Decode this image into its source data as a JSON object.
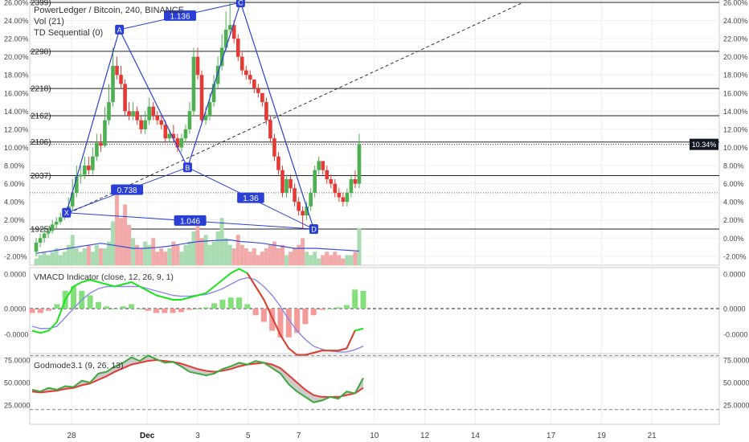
{
  "header": {
    "symbol_line": "PowerLedger / Bitcoin, 240, BINANCE",
    "vol_line": "Vol (21)",
    "td_line": "TD Sequential (0)"
  },
  "macd_panel": {
    "label": "VMACD Indicator (close, 12, 26, 9, 1)"
  },
  "godmode_panel": {
    "label": "Godmode3.1 (9, 26, 13)"
  },
  "colors": {
    "up": "#4caf50",
    "down": "#e53935",
    "pattern": "#2a3fd6",
    "macd_line": "#19e619",
    "signal_line": "#8888ee",
    "godmode_green": "#3ea83e",
    "godmode_red": "#e53935",
    "shade": "#bfbfbf"
  },
  "chart_data": [
    {
      "type": "line",
      "title": "PowerLedger / Bitcoin, 240, BINANCE",
      "ylim": [
        -2.0,
        26.0
      ],
      "y_ticks": [
        "26.00%",
        "24.00%",
        "22.00%",
        "20.00%",
        "18.00%",
        "16.00%",
        "14.00%",
        "12.00%",
        "10.00%",
        "8.00%",
        "6.00%",
        "4.00%",
        "2.00%",
        "0.00%",
        "-2.00%"
      ],
      "x_ticks": [
        "28",
        "Dec",
        "3",
        "5",
        "7",
        "10",
        "12",
        "14",
        "17",
        "19",
        "21"
      ],
      "x_tick_days": [
        28,
        31,
        33,
        35,
        37,
        40,
        42,
        44,
        47,
        49,
        51
      ],
      "price_levels": [
        {
          "label": "2399",
          "value": 26.0
        },
        {
          "label": "2298",
          "value": 20.6
        },
        {
          "label": "2218",
          "value": 16.5
        },
        {
          "label": "2162",
          "value": 13.5
        },
        {
          "label": "2106",
          "value": 10.6
        },
        {
          "label": "2037",
          "value": 6.9
        },
        {
          "label": "1925",
          "value": 1.0
        }
      ],
      "current_value_label": "10.34%",
      "current_value": 10.34,
      "harmonic_pattern": {
        "points": [
          {
            "label": "X",
            "day": 27.8,
            "value": 2.8
          },
          {
            "label": "A",
            "day": 29.9,
            "value": 23.0
          },
          {
            "label": "B",
            "day": 32.6,
            "value": 7.8
          },
          {
            "label": "C",
            "day": 34.7,
            "value": 26.0
          },
          {
            "label": "D",
            "day": 37.6,
            "value": 1.0
          }
        ],
        "ratios": [
          {
            "label": "1.136",
            "between": "A-C"
          },
          {
            "label": "0.738",
            "between": "X-B"
          },
          {
            "label": "1.36",
            "between": "B-D"
          },
          {
            "label": "1.046",
            "between": "X-D"
          }
        ]
      },
      "series": [
        {
          "kind": "candlestick",
          "days": [
            26.6,
            26.76,
            26.92,
            27.08,
            27.24,
            27.4,
            27.56,
            27.72,
            27.88,
            28.04,
            28.2,
            28.36,
            28.52,
            28.68,
            28.84,
            29.0,
            29.16,
            29.32,
            29.48,
            29.64,
            29.8,
            29.96,
            30.12,
            30.28,
            30.44,
            30.6,
            30.76,
            30.92,
            31.08,
            31.24,
            31.4,
            31.56,
            31.72,
            31.88,
            32.04,
            32.2,
            32.36,
            32.52,
            32.68,
            32.84,
            33.0,
            33.16,
            33.32,
            33.48,
            33.64,
            33.8,
            33.96,
            34.12,
            34.28,
            34.44,
            34.6,
            34.76,
            34.92,
            35.08,
            35.24,
            35.4,
            35.56,
            35.72,
            35.88,
            36.04,
            36.2,
            36.36,
            36.52,
            36.68,
            36.84,
            37.0,
            37.16,
            37.32,
            37.48,
            37.64,
            37.8,
            37.96,
            38.12,
            38.28,
            38.44,
            38.6,
            38.76,
            38.92,
            39.08,
            39.24,
            39.4
          ],
          "open": [
            -1.5,
            -0.5,
            0.0,
            0.5,
            0.8,
            1.5,
            1.8,
            2.3,
            2.8,
            3.5,
            5.0,
            6.8,
            7.0,
            8.0,
            7.5,
            9.0,
            10.5,
            10.2,
            13.0,
            15.0,
            19.0,
            18.0,
            17.0,
            14.0,
            13.5,
            14.0,
            13.0,
            12.0,
            13.0,
            14.5,
            13.5,
            13.0,
            12.5,
            11.0,
            11.5,
            11.0,
            10.0,
            11.0,
            12.0,
            14.0,
            20.0,
            18.0,
            13.0,
            13.5,
            15.0,
            17.0,
            19.0,
            21.0,
            23.0,
            23.5,
            22.0,
            20.0,
            18.5,
            18.0,
            17.5,
            16.5,
            16.0,
            15.0,
            13.0,
            11.0,
            9.0,
            7.5,
            5.0,
            6.5,
            5.5,
            4.0,
            3.0,
            2.5,
            3.5,
            5.0,
            7.5,
            8.5,
            7.5,
            6.5,
            6.0,
            5.0,
            4.5,
            4.0,
            5.0,
            6.5,
            6.0
          ],
          "close": [
            -0.5,
            0.0,
            0.5,
            0.8,
            1.5,
            1.8,
            2.3,
            2.8,
            3.5,
            5.0,
            6.8,
            7.0,
            8.0,
            7.5,
            9.0,
            10.5,
            10.2,
            13.0,
            15.0,
            19.0,
            18.0,
            17.0,
            14.0,
            13.5,
            14.0,
            13.0,
            12.0,
            13.0,
            14.5,
            13.5,
            13.0,
            12.5,
            11.0,
            11.5,
            11.0,
            10.0,
            11.0,
            12.0,
            14.0,
            20.0,
            18.0,
            13.0,
            13.5,
            15.0,
            17.0,
            19.0,
            21.0,
            23.0,
            23.5,
            22.0,
            20.0,
            18.5,
            18.0,
            17.5,
            16.5,
            16.0,
            15.0,
            13.0,
            11.0,
            9.0,
            7.5,
            5.0,
            6.5,
            5.5,
            4.0,
            3.0,
            2.5,
            3.5,
            5.0,
            7.5,
            8.5,
            7.5,
            6.5,
            6.0,
            5.0,
            4.5,
            4.0,
            5.0,
            6.5,
            6.0,
            10.34
          ],
          "high": [
            0.0,
            0.5,
            1.0,
            1.2,
            2.0,
            2.3,
            2.8,
            3.3,
            4.5,
            6.5,
            8.0,
            8.0,
            9.0,
            9.0,
            10.0,
            11.5,
            11.5,
            14.5,
            17.0,
            21.0,
            20.0,
            19.0,
            17.5,
            15.0,
            15.0,
            14.5,
            13.5,
            14.0,
            15.5,
            15.0,
            14.0,
            13.5,
            13.0,
            12.0,
            12.5,
            11.5,
            11.5,
            12.5,
            15.0,
            21.0,
            21.0,
            18.5,
            14.5,
            16.0,
            18.0,
            20.0,
            22.5,
            25.0,
            26.0,
            24.0,
            22.5,
            20.5,
            19.0,
            18.5,
            17.5,
            17.0,
            16.0,
            15.5,
            13.5,
            11.5,
            9.5,
            8.0,
            7.0,
            7.0,
            6.0,
            4.5,
            3.5,
            4.0,
            5.5,
            8.0,
            9.0,
            8.5,
            8.0,
            7.0,
            6.5,
            5.5,
            5.0,
            5.5,
            7.0,
            7.5,
            11.5
          ],
          "low": [
            -2.0,
            -1.0,
            -0.5,
            0.0,
            0.5,
            1.0,
            1.5,
            2.0,
            2.5,
            3.0,
            4.5,
            6.0,
            6.5,
            7.0,
            7.0,
            8.5,
            9.5,
            10.0,
            12.5,
            14.5,
            17.5,
            16.5,
            13.5,
            13.0,
            13.0,
            12.5,
            11.5,
            11.5,
            12.5,
            13.0,
            12.5,
            12.0,
            10.5,
            10.5,
            10.5,
            9.5,
            9.5,
            10.5,
            11.5,
            13.5,
            17.5,
            12.5,
            12.5,
            13.0,
            14.5,
            16.5,
            18.5,
            20.5,
            22.5,
            21.5,
            19.5,
            18.0,
            17.5,
            17.0,
            16.0,
            15.5,
            14.5,
            12.5,
            10.5,
            8.5,
            7.0,
            4.5,
            4.5,
            5.0,
            3.5,
            2.5,
            1.0,
            2.0,
            3.0,
            4.5,
            7.0,
            7.0,
            6.0,
            5.5,
            4.5,
            4.0,
            3.5,
            3.5,
            4.5,
            5.5,
            5.5
          ]
        },
        {
          "kind": "volume",
          "values": [
            2,
            3,
            4,
            3,
            4,
            5,
            3,
            4,
            6,
            9,
            5,
            4,
            5,
            6,
            4,
            6,
            5,
            5,
            7,
            13,
            22,
            14,
            18,
            12,
            8,
            6,
            5,
            7,
            6,
            8,
            4,
            5,
            4,
            5,
            7,
            6,
            4,
            6,
            7,
            10,
            12,
            8,
            9,
            6,
            7,
            10,
            14,
            8,
            6,
            5,
            9,
            6,
            5,
            4,
            5,
            3,
            4,
            5,
            6,
            7,
            5,
            6,
            3,
            4,
            5,
            6,
            8,
            4,
            3,
            4,
            2,
            3,
            4,
            3,
            4,
            3,
            2,
            3,
            3,
            4,
            11
          ]
        },
        {
          "kind": "line",
          "name": "Vol (21)",
          "values": [
            3.5,
            4.0,
            4.5,
            5.0,
            5.5,
            6.0,
            6.5,
            6.0,
            5.5,
            5.0,
            5.0,
            5.2,
            5.5,
            6.0,
            6.5,
            7.0,
            7.2,
            7.4,
            7.5,
            7.0,
            6.8,
            6.5,
            6.0,
            5.5,
            5.0,
            5.0,
            5.0,
            4.8,
            4.6,
            4.4,
            4.2
          ]
        }
      ]
    },
    {
      "type": "line",
      "title": "VMACD Indicator (close, 12, 26, 9, 1)",
      "ylim": [
        -0.00012,
        0.00012
      ],
      "y_ticks": [
        "0.0000",
        "0.0000",
        "-0.0000"
      ],
      "series": [
        {
          "name": "MACD",
          "values": [
            -5,
            -5.5,
            -5,
            -3,
            2,
            5,
            6,
            6.5,
            6,
            5.5,
            5,
            5.5,
            6,
            5,
            4,
            3,
            2.5,
            2,
            2,
            2.5,
            3,
            3.5,
            5,
            6.5,
            8,
            9,
            8,
            5,
            2,
            -2,
            -6,
            -9,
            -10.5,
            -10.5,
            -10,
            -9.5,
            -9.5,
            -9.5,
            -9,
            -5,
            -4.5
          ]
        },
        {
          "name": "Signal",
          "values": [
            -4,
            -4.5,
            -4.5,
            -4,
            -2,
            0,
            2,
            3.5,
            4.5,
            5,
            5,
            5,
            5,
            5,
            4.5,
            4,
            3.5,
            3,
            2.8,
            2.8,
            3,
            3.2,
            3.8,
            4.5,
            5.5,
            6.5,
            7,
            6.5,
            5,
            3,
            0.5,
            -2.5,
            -5,
            -7,
            -8.5,
            -9.2,
            -9.6,
            -9.8,
            -9.8,
            -9.3,
            -8.5
          ]
        },
        {
          "kind": "histogram",
          "values": [
            -1,
            -1,
            -0.5,
            1,
            4,
            5,
            4,
            3,
            1.5,
            0.5,
            0,
            0.5,
            1,
            0,
            -0.5,
            -1,
            -1,
            -1,
            -0.8,
            -0.3,
            0,
            0.3,
            1.2,
            2,
            2.5,
            2.5,
            1,
            -1.5,
            -3,
            -5,
            -6.5,
            -6.5,
            -5.5,
            -3.5,
            -1.5,
            -0.3,
            0,
            0.3,
            0.8,
            4.3,
            4
          ]
        }
      ]
    },
    {
      "type": "line",
      "title": "Godmode3.1 (9, 26, 13)",
      "ylim": [
        15,
        85
      ],
      "y_ticks": [
        "75.0000",
        "50.0000",
        "25.0000"
      ],
      "reference_lines": [
        80,
        20
      ],
      "series": [
        {
          "name": "Green",
          "values": [
            42,
            40,
            44,
            42,
            46,
            45,
            52,
            50,
            60,
            62,
            68,
            72,
            78,
            74,
            80,
            76,
            72,
            73,
            68,
            62,
            60,
            58,
            60,
            65,
            68,
            72,
            70,
            74,
            72,
            66,
            60,
            48,
            40,
            34,
            28,
            30,
            34,
            32,
            40,
            38,
            55
          ]
        },
        {
          "name": "Red",
          "values": [
            40,
            39,
            40,
            41,
            43,
            44,
            47,
            49,
            53,
            57,
            62,
            66,
            70,
            72,
            74,
            75,
            74,
            73,
            71,
            68,
            65,
            63,
            62,
            63,
            65,
            68,
            70,
            71,
            72,
            70,
            66,
            58,
            50,
            42,
            36,
            34,
            34,
            34,
            36,
            38,
            44
          ]
        }
      ]
    }
  ]
}
